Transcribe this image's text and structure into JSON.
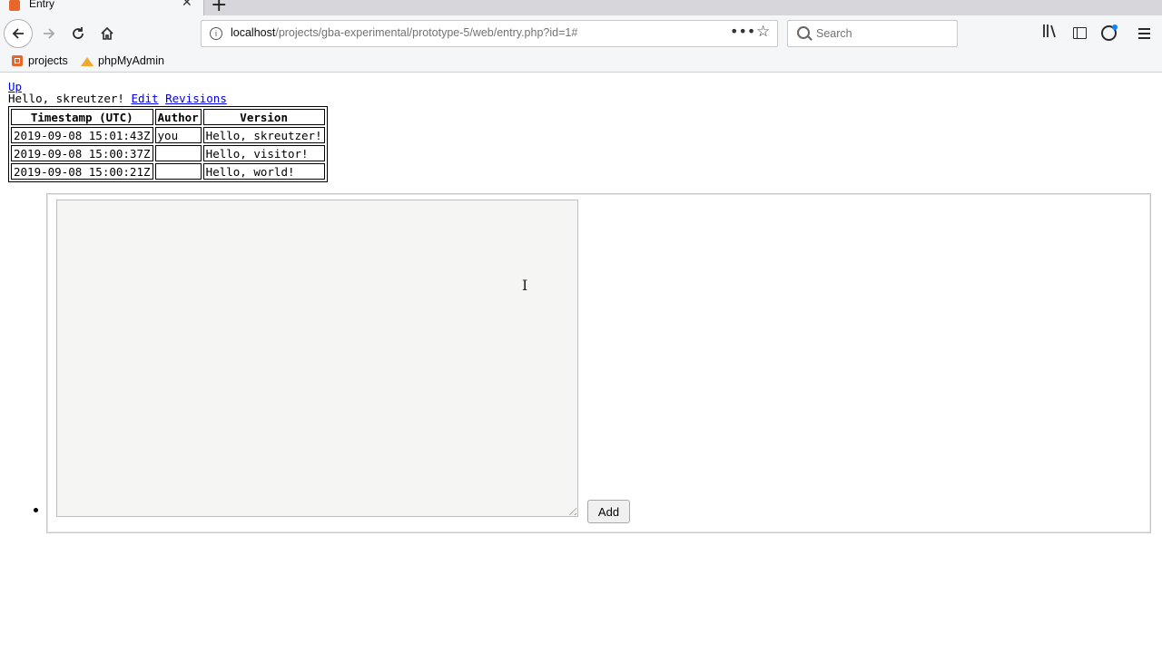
{
  "browser": {
    "tab_title": "Entry",
    "tab_close": "✕",
    "new_tab": "+",
    "url_host": "localhost",
    "url_path": "/projects/gba-experimental/prototype-5/web/entry.php?id=1#",
    "search_placeholder": "Search",
    "bookmarks": [
      "projects",
      "phpMyAdmin"
    ],
    "icons": {
      "back": "back-arrow-icon",
      "forward": "forward-arrow-icon",
      "reload": "reload-icon",
      "home": "home-icon",
      "info": "info-icon",
      "more": "more-icon",
      "star": "bookmark-star-icon",
      "search": "search-icon",
      "library": "library-icon",
      "sidebar": "sidebar-icon",
      "account": "account-icon",
      "menu": "menu-icon"
    }
  },
  "page": {
    "up_link": "Up",
    "greeting": "Hello, skreutzer!",
    "edit_link": "Edit",
    "revisions_link": "Revisions",
    "table": {
      "headers": [
        "Timestamp (UTC)",
        "Author",
        "Version"
      ],
      "rows": [
        [
          "2019-09-08 15:01:43Z",
          "you",
          "Hello, skreutzer!"
        ],
        [
          "2019-09-08 15:00:37Z",
          "",
          "Hello, visitor!"
        ],
        [
          "2019-09-08 15:00:21Z",
          "",
          "Hello, world!"
        ]
      ]
    },
    "textarea_value": "",
    "add_button": "Add"
  }
}
